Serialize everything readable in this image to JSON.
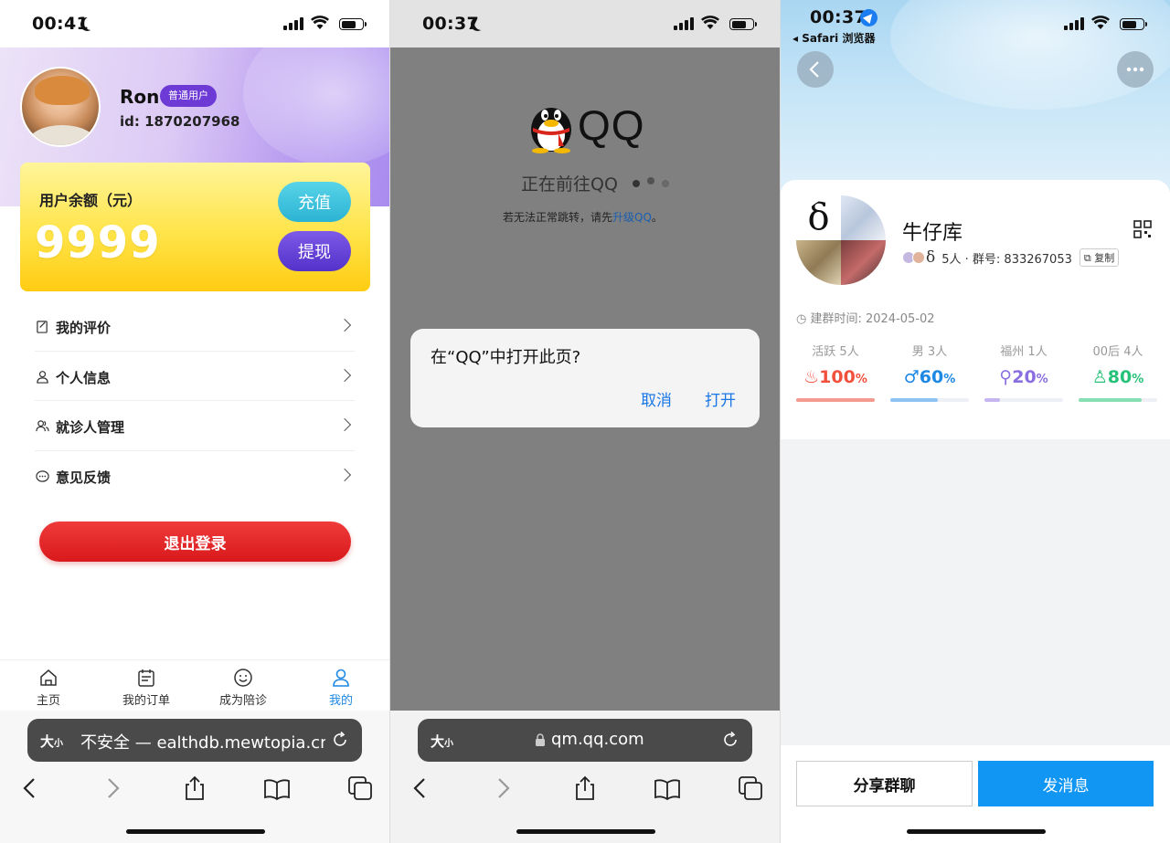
{
  "screen1": {
    "status": {
      "time": "00:41"
    },
    "profile": {
      "name": "Ron",
      "badge": "普通用户",
      "id": "id: 1870207968"
    },
    "wallet": {
      "label": "用户余额（元）",
      "amount": "9999",
      "recharge": "充值",
      "withdraw": "提现"
    },
    "menu": [
      {
        "label": "我的评价",
        "icon": "review-icon"
      },
      {
        "label": "个人信息",
        "icon": "person-icon"
      },
      {
        "label": "就诊人管理",
        "icon": "patients-icon"
      },
      {
        "label": "意见反馈",
        "icon": "feedback-icon"
      }
    ],
    "logout": "退出登录",
    "tabs": [
      {
        "label": "主页",
        "icon": "home-icon"
      },
      {
        "label": "我的订单",
        "icon": "orders-icon"
      },
      {
        "label": "成为陪诊",
        "icon": "smile-icon"
      },
      {
        "label": "我的",
        "icon": "user-icon",
        "active": true
      }
    ],
    "safari": {
      "aa": "大",
      "aa_small": "小",
      "url": "不安全 — ealthdb.mewtopia.cn"
    }
  },
  "screen2": {
    "status": {
      "time": "00:37"
    },
    "brand": "QQ",
    "going": "正在前往QQ",
    "hint_prefix": "若无法正常跳转，请先",
    "hint_link": "升级QQ",
    "hint_suffix": "。",
    "dialog": {
      "message": "在“QQ”中打开此页?",
      "cancel": "取消",
      "open": "打开"
    },
    "safari": {
      "aa": "大",
      "aa_small": "小",
      "url": "qm.qq.com"
    }
  },
  "screen3": {
    "status": {
      "time": "00:37",
      "back_app": "◂ Safari 浏览器"
    },
    "group": {
      "name": "牛仔库",
      "members": "5人 · 群号: 833267053",
      "copy": "复制",
      "created": "建群时间: 2024-05-02"
    },
    "stats": [
      {
        "label": "活跃 5人",
        "value": "100",
        "unit": "%",
        "fill": 1.0,
        "color": "#f0503c",
        "bar": "#f59a8e",
        "icon": "fire-icon"
      },
      {
        "label": "男 3人",
        "value": "60",
        "unit": "%",
        "fill": 0.6,
        "color": "#1e88e5",
        "bar": "#8ec2f3",
        "icon": "male-icon"
      },
      {
        "label": "福州 1人",
        "value": "20",
        "unit": "%",
        "fill": 0.2,
        "color": "#8a6fe0",
        "bar": "#c5b6f2",
        "icon": "location-icon"
      },
      {
        "label": "00后 4人",
        "value": "80",
        "unit": "%",
        "fill": 0.8,
        "color": "#27c27a",
        "bar": "#86dfb3",
        "icon": "person-icon"
      }
    ],
    "actions": {
      "share": "分享群聊",
      "send": "发消息"
    }
  }
}
